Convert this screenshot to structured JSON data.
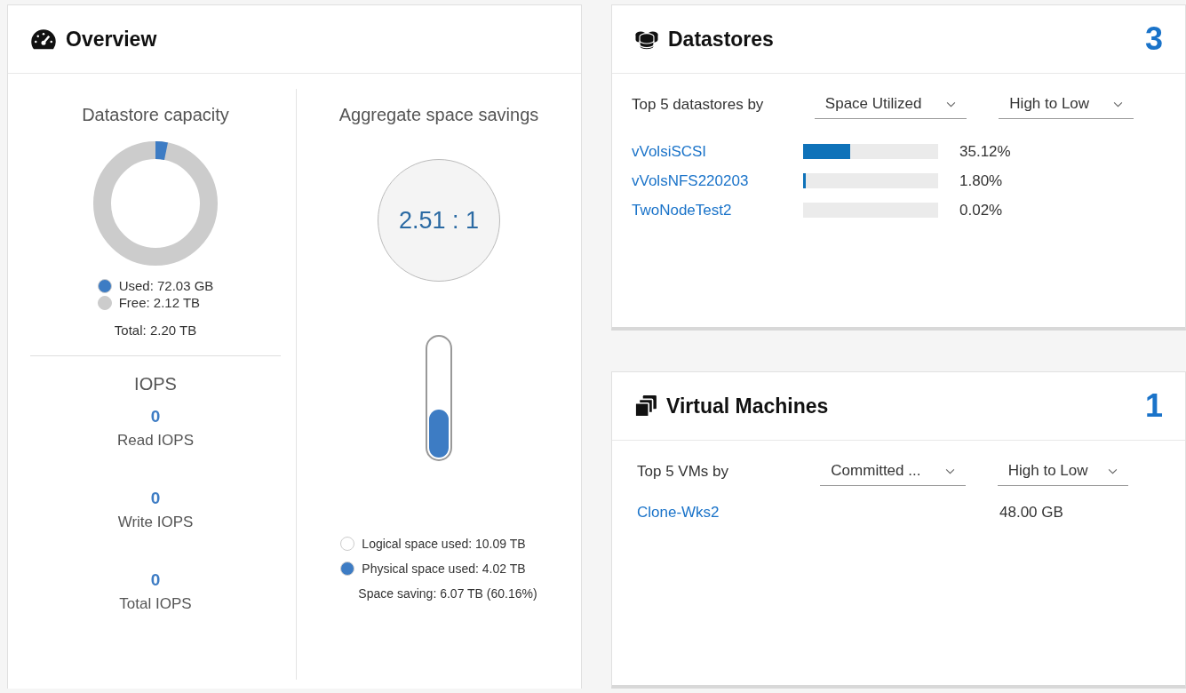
{
  "overview": {
    "title": "Overview",
    "capacity": {
      "title": "Datastore capacity",
      "level": 0.032,
      "legend": [
        {
          "label": "Used: 72.03 GB",
          "color": "#3d7cc4"
        },
        {
          "label": "Free: 2.12 TB",
          "color": "#cccccc"
        }
      ],
      "total": "Total: 2.20 TB"
    },
    "iops": {
      "title": "IOPS",
      "metrics": [
        {
          "value": "0",
          "label": "Read IOPS"
        },
        {
          "value": "0",
          "label": "Write IOPS"
        },
        {
          "value": "0",
          "label": "Total IOPS"
        }
      ]
    },
    "savings": {
      "title": "Aggregate space savings",
      "ratio": "2.51 : 1",
      "level": 0.4,
      "legend": [
        {
          "label": "Logical space used: 10.09 TB",
          "color": "#ffffff"
        },
        {
          "label": "Physical space used: 4.02 TB",
          "color": "#3d7cc4"
        }
      ],
      "saving": "Space saving: 6.07 TB (60.16%)"
    }
  },
  "datastores": {
    "title": "Datastores",
    "count": "3",
    "filter_label": "Top 5 datastores by",
    "metric": "Space Utilized",
    "order": "High to Low",
    "rows": [
      {
        "name": "vVolsiSCSI",
        "level": 0.3512,
        "reading": "35.12%"
      },
      {
        "name": "vVolsNFS220203",
        "level": 0.018,
        "reading": "1.80%"
      },
      {
        "name": "TwoNodeTest2",
        "level": 0.0002,
        "reading": "0.02%"
      }
    ]
  },
  "virtual_machines": {
    "title": "Virtual Machines",
    "count": "1",
    "filter_label": "Top 5 VMs by",
    "metric": "Committed ...",
    "order": "High to Low",
    "rows": [
      {
        "name": "Clone-Wks2",
        "reading": "48.00 GB"
      }
    ]
  }
}
